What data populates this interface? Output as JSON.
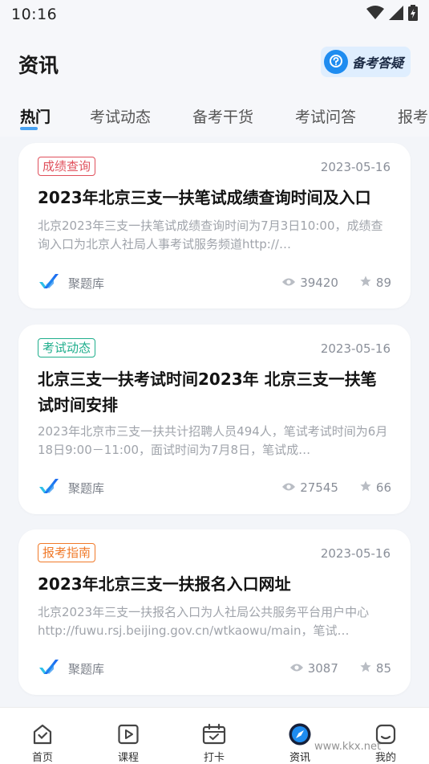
{
  "status_bar": {
    "time": "10:16"
  },
  "header": {
    "title": "资讯",
    "qa_button_label": "备考答疑"
  },
  "tabs": [
    {
      "label": "热门",
      "active": true
    },
    {
      "label": "考试动态",
      "active": false
    },
    {
      "label": "备考干货",
      "active": false
    },
    {
      "label": "考试问答",
      "active": false
    },
    {
      "label": "报考",
      "active": false
    }
  ],
  "articles": [
    {
      "tag": "成绩查询",
      "tag_color": "#e0505c",
      "date": "2023-05-16",
      "title": "2023年北京三支一扶笔试成绩查询时间及入口",
      "summary": "北京2023年三支一扶笔试成绩查询时间为7月3日10:00，成绩查询入口为北京人社局人事考试服务频道http://…",
      "source": "聚题库",
      "views": "39420",
      "likes": "89"
    },
    {
      "tag": "考试动态",
      "tag_color": "#1fae8c",
      "date": "2023-05-16",
      "title": "北京三支一扶考试时间2023年 北京三支一扶笔试时间安排",
      "summary": "2023年北京市三支一扶共计招聘人员494人，笔试考试时间为6月18日9:00－11:00，面试时间为7月8日，笔试成…",
      "source": "聚题库",
      "views": "27545",
      "likes": "66"
    },
    {
      "tag": "报考指南",
      "tag_color": "#f07a2a",
      "date": "2023-05-16",
      "title": "2023年北京三支一扶报名入口网址",
      "summary": "北京2023年三支一扶报名入口为人社局公共服务平台用户中心http://fuwu.rsj.beijing.gov.cn/wtkaowu/main，笔试…",
      "source": "聚题库",
      "views": "3087",
      "likes": "85"
    }
  ],
  "bottom_nav": [
    {
      "label": "首页",
      "icon": "home-icon"
    },
    {
      "label": "课程",
      "icon": "play-icon"
    },
    {
      "label": "打卡",
      "icon": "calendar-check-icon"
    },
    {
      "label": "资讯",
      "icon": "compass-icon",
      "active": true
    },
    {
      "label": "我的",
      "icon": "profile-icon"
    }
  ],
  "watermark": "www.kkx.net",
  "colors": {
    "accent": "#1e8cf0",
    "background": "#f3f5f9"
  }
}
